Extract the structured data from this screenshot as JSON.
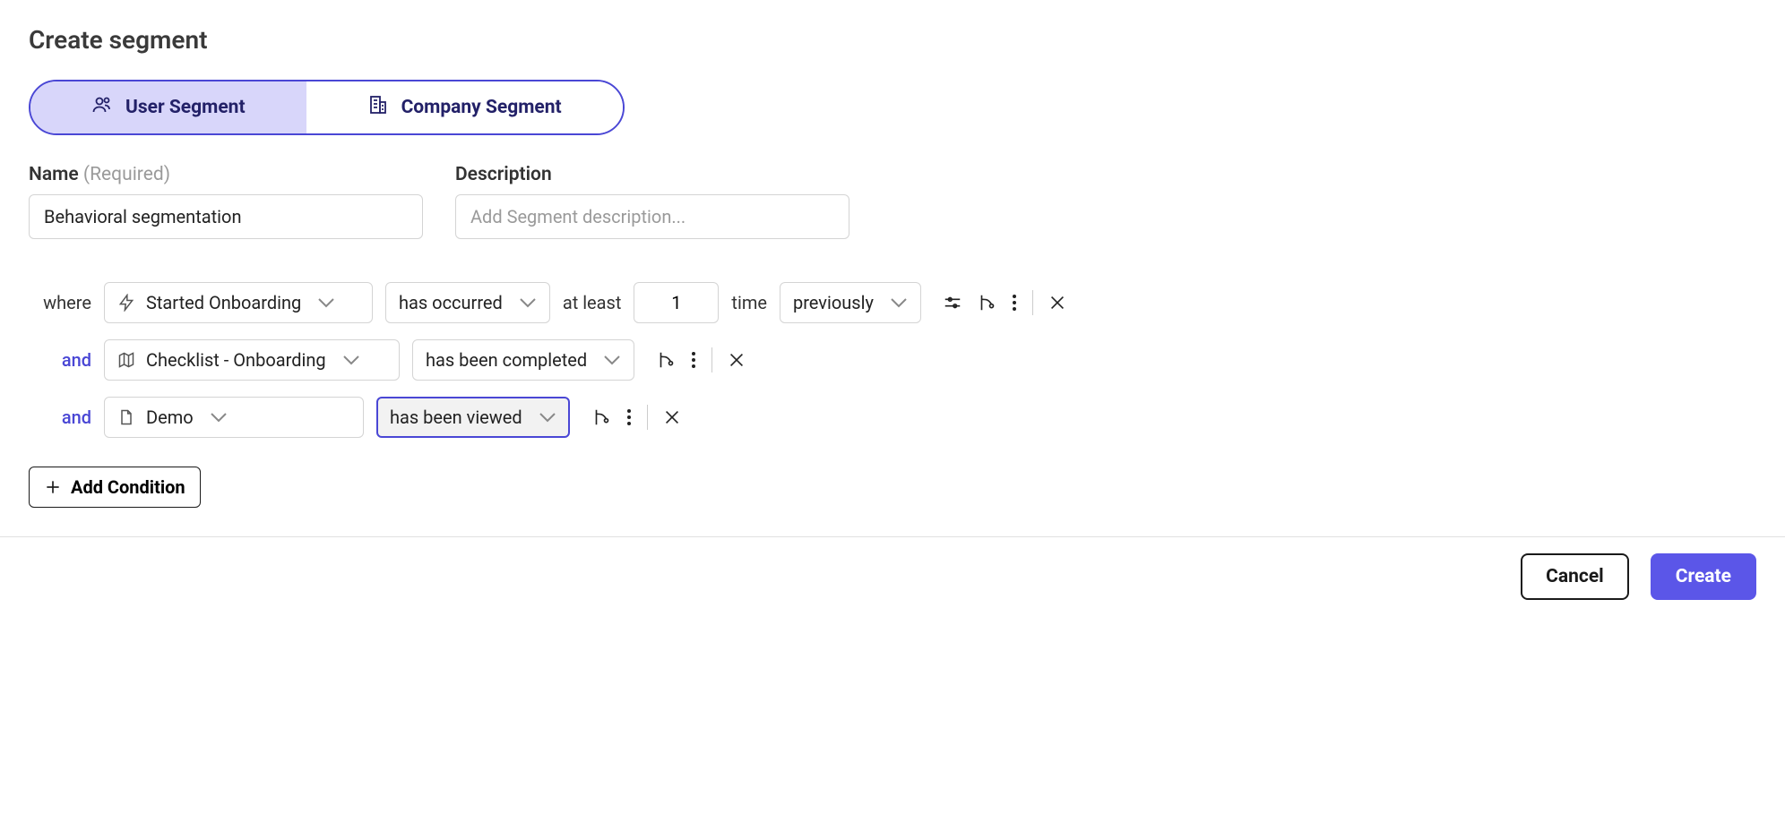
{
  "title": "Create segment",
  "tabs": {
    "user": "User Segment",
    "company": "Company Segment"
  },
  "form": {
    "name_label": "Name",
    "name_hint": "(Required)",
    "name_value": "Behavioral segmentation",
    "description_label": "Description",
    "description_placeholder": "Add Segment description..."
  },
  "conditions": [
    {
      "prefix": "where",
      "event": "Started Onboarding",
      "operator": "has occurred",
      "at_least_label": "at least",
      "count": "1",
      "unit": "time",
      "timeframe": "previously"
    },
    {
      "prefix": "and",
      "event": "Checklist  - Onboarding",
      "operator": "has been completed"
    },
    {
      "prefix": "and",
      "event": "Demo",
      "operator": "has been viewed"
    }
  ],
  "add_condition_label": "Add Condition",
  "footer": {
    "cancel": "Cancel",
    "create": "Create"
  }
}
